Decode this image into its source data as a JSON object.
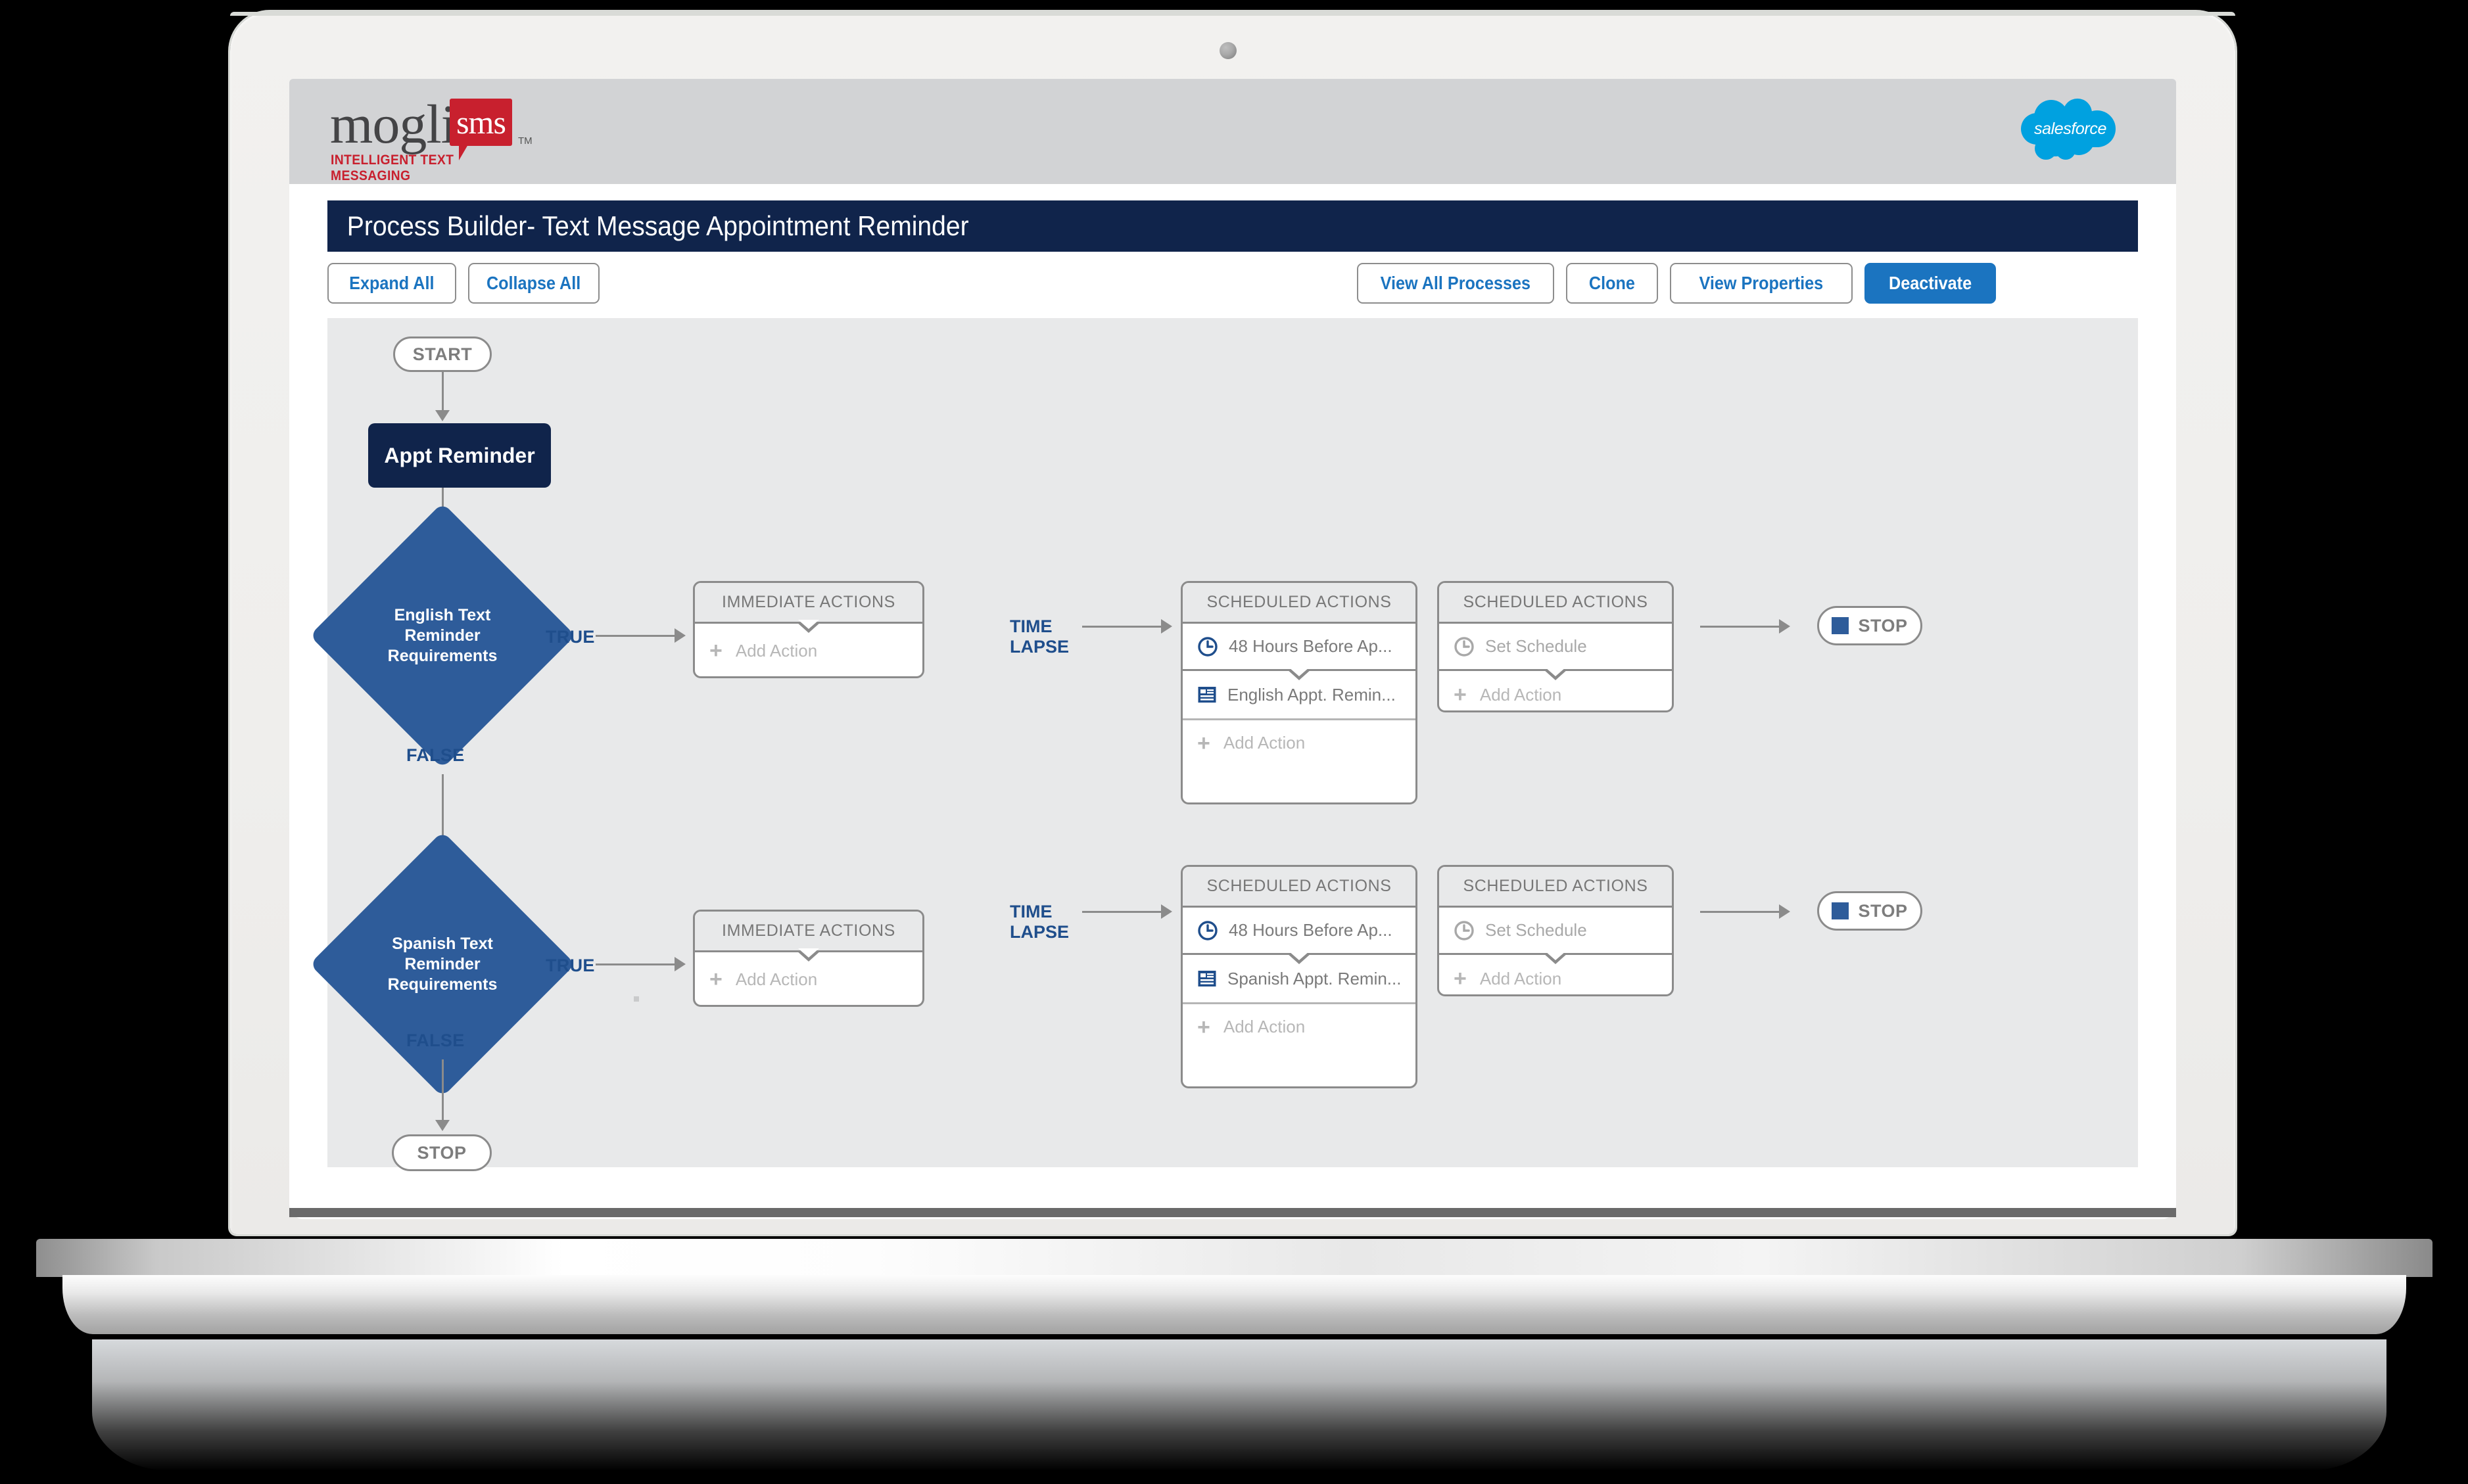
{
  "header": {
    "logo_name": "mogli-sms-logo",
    "logo_word": "mogli",
    "logo_badge": "sms",
    "logo_tm": "TM",
    "logo_tagline": "INTELLIGENT TEXT MESSAGING",
    "salesforce_logo_text": "salesforce",
    "brand_red": "#c8202e",
    "salesforce_blue": "#00a1e0",
    "header_bg": "#d2d3d5"
  },
  "title_bar": {
    "title": "Process Builder- Text Message Appointment Reminder",
    "bg": "#10244b"
  },
  "toolbar": {
    "expand_all": "Expand All",
    "collapse_all": "Collapse  All",
    "view_all_processes": "View All Processes",
    "clone": "Clone",
    "view_properties": "View Properties",
    "deactivate": "Deactivate",
    "link_blue": "#1b74c0"
  },
  "canvas": {
    "bg": "#e8e9ea",
    "start_label": "START",
    "trigger_node": "Appt Reminder",
    "stop_label": "STOP",
    "time_lapse_line1": "TIME",
    "time_lapse_line2": "LAPSE",
    "immediate_actions_header": "IMMEDIATE ACTIONS",
    "scheduled_actions_header": "SCHEDULED ACTIONS",
    "add_action": "Add Action",
    "plus": "+",
    "set_schedule": "Set Schedule",
    "true_label": "TRUE",
    "false_label": "FALSE",
    "diamond_blue": "#2e5c9a",
    "node_navy": "#10244b",
    "connector_gray": "#8b8b8b"
  },
  "branches": [
    {
      "id": "english",
      "diamond_line1": "English Text",
      "diamond_line2": "Reminder",
      "diamond_line3": "Requirements",
      "true_label": "TRUE",
      "false_label": "FALSE",
      "immediate_header": "IMMEDIATE ACTIONS",
      "immediate_add": "Add Action",
      "scheduled_header": "SCHEDULED ACTIONS",
      "schedule_time": "48 Hours Before Ap...",
      "action_name": "English Appt. Remin...",
      "scheduled_add": "Add Action",
      "second_scheduled_header": "SCHEDULED ACTIONS",
      "set_schedule": "Set Schedule",
      "second_add": "Add Action",
      "stop_label": "STOP"
    },
    {
      "id": "spanish",
      "diamond_line1": "Spanish Text",
      "diamond_line2": "Reminder",
      "diamond_line3": "Requirements",
      "true_label": "TRUE",
      "false_label": "FALSE",
      "immediate_header": "IMMEDIATE ACTIONS",
      "immediate_add": "Add Action",
      "scheduled_header": "SCHEDULED ACTIONS",
      "schedule_time": "48 Hours Before Ap...",
      "action_name": "Spanish Appt. Remin...",
      "scheduled_add": "Add Action",
      "second_scheduled_header": "SCHEDULED ACTIONS",
      "set_schedule": "Set Schedule",
      "second_add": "Add Action",
      "stop_label": "STOP"
    }
  ],
  "final_stop": {
    "label": "STOP"
  }
}
